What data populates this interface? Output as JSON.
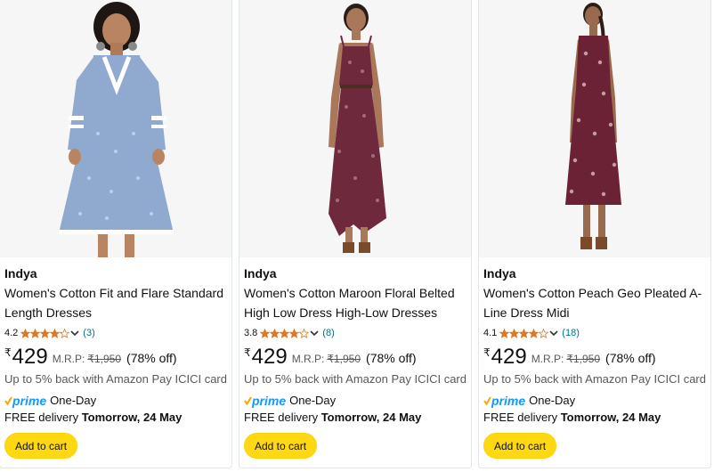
{
  "colors": {
    "button_bg": "#ffd814",
    "star": "#de7921",
    "link": "#007185",
    "prime": "#1399ff"
  },
  "products": [
    {
      "image": "blue-printed-cotton-dress",
      "brand": "Indya",
      "title": "Women's Cotton Fit and Flare Standard Length Dresses",
      "rating": "4.2",
      "stars": 4.2,
      "reviews": "(3)",
      "currency": "₹",
      "price": "429",
      "mrp_label": "M.R.P:",
      "mrp": "₹1,950",
      "discount": "(78% off)",
      "cashback": "Up to 5% back with Amazon Pay ICICI card",
      "prime": "prime",
      "one_day": "One-Day",
      "delivery_prefix": "FREE delivery",
      "delivery_date": "Tomorrow, 24 May",
      "cart": "Add to cart"
    },
    {
      "image": "maroon-floral-belted-dress",
      "brand": "Indya",
      "title": "Women's Cotton Maroon Floral Belted High Low Dress High-Low Dresses",
      "rating": "3.8",
      "stars": 3.8,
      "reviews": "(8)",
      "currency": "₹",
      "price": "429",
      "mrp_label": "M.R.P:",
      "mrp": "₹1,950",
      "discount": "(78% off)",
      "cashback": "Up to 5% back with Amazon Pay ICICI card",
      "prime": "prime",
      "one_day": "One-Day",
      "delivery_prefix": "FREE delivery",
      "delivery_date": "Tomorrow, 24 May",
      "cart": "Add to cart"
    },
    {
      "image": "peach-geo-pleated-midi-dress",
      "brand": "Indya",
      "title": "Women's Cotton Peach Geo Pleated A-Line Dress Midi",
      "rating": "4.1",
      "stars": 4.1,
      "reviews": "(18)",
      "currency": "₹",
      "price": "429",
      "mrp_label": "M.R.P:",
      "mrp": "₹1,950",
      "discount": "(78% off)",
      "cashback": "Up to 5% back with Amazon Pay ICICI card",
      "prime": "prime",
      "one_day": "One-Day",
      "delivery_prefix": "FREE delivery",
      "delivery_date": "Tomorrow, 24 May",
      "cart": "Add to cart"
    }
  ]
}
